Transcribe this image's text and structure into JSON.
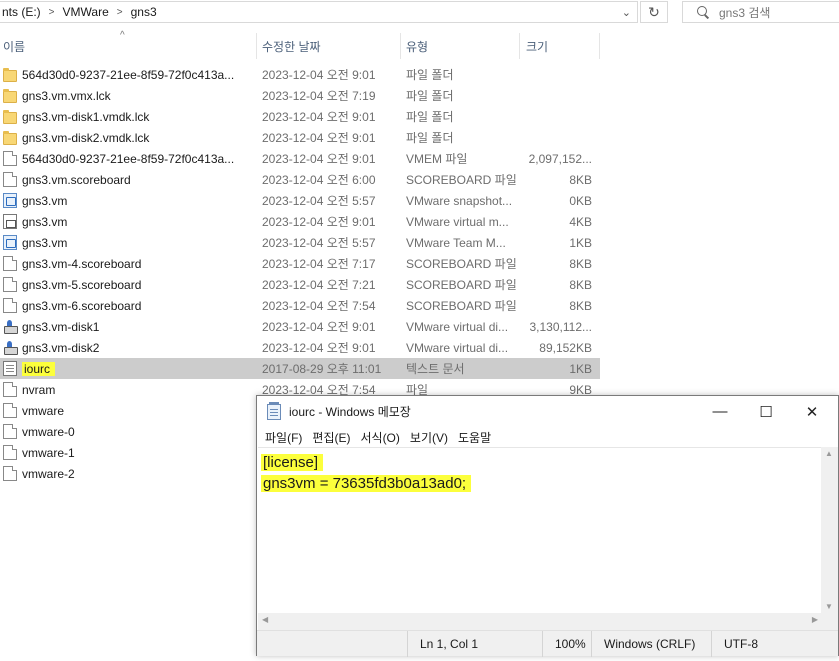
{
  "address": {
    "crumbs": [
      "nts (E:)",
      "VMWare",
      "gns3"
    ],
    "separator": ">",
    "dropdown_icon": "chevron-down-icon",
    "refresh_icon": "refresh-icon"
  },
  "search": {
    "placeholder": "gns3 검색"
  },
  "columns": {
    "name": "이름",
    "date": "수정한 날짜",
    "type": "유형",
    "size": "크기"
  },
  "files": [
    {
      "name": "564d30d0-9237-21ee-8f59-72f0c413a...",
      "date": "2023-12-04 오전 9:01",
      "type": "파일 폴더",
      "size": "",
      "icon": "folder"
    },
    {
      "name": "gns3.vm.vmx.lck",
      "date": "2023-12-04 오전 7:19",
      "type": "파일 폴더",
      "size": "",
      "icon": "folder"
    },
    {
      "name": "gns3.vm-disk1.vmdk.lck",
      "date": "2023-12-04 오전 9:01",
      "type": "파일 폴더",
      "size": "",
      "icon": "folder"
    },
    {
      "name": "gns3.vm-disk2.vmdk.lck",
      "date": "2023-12-04 오전 9:01",
      "type": "파일 폴더",
      "size": "",
      "icon": "folder"
    },
    {
      "name": "564d30d0-9237-21ee-8f59-72f0c413a...",
      "date": "2023-12-04 오전 9:01",
      "type": "VMEM 파일",
      "size": "2,097,152...",
      "icon": "doc"
    },
    {
      "name": "gns3.vm.scoreboard",
      "date": "2023-12-04 오전 6:00",
      "type": "SCOREBOARD 파일",
      "size": "8KB",
      "icon": "doc"
    },
    {
      "name": "gns3.vm",
      "date": "2023-12-04 오전 5:57",
      "type": "VMware snapshot...",
      "size": "0KB",
      "icon": "vmsnap"
    },
    {
      "name": "gns3.vm",
      "date": "2023-12-04 오전 9:01",
      "type": "VMware virtual m...",
      "size": "4KB",
      "icon": "vmx"
    },
    {
      "name": "gns3.vm",
      "date": "2023-12-04 오전 5:57",
      "type": "VMware Team M...",
      "size": "1KB",
      "icon": "vmsnap"
    },
    {
      "name": "gns3.vm-4.scoreboard",
      "date": "2023-12-04 오전 7:17",
      "type": "SCOREBOARD 파일",
      "size": "8KB",
      "icon": "doc"
    },
    {
      "name": "gns3.vm-5.scoreboard",
      "date": "2023-12-04 오전 7:21",
      "type": "SCOREBOARD 파일",
      "size": "8KB",
      "icon": "doc"
    },
    {
      "name": "gns3.vm-6.scoreboard",
      "date": "2023-12-04 오전 7:54",
      "type": "SCOREBOARD 파일",
      "size": "8KB",
      "icon": "doc"
    },
    {
      "name": "gns3.vm-disk1",
      "date": "2023-12-04 오전 9:01",
      "type": "VMware virtual di...",
      "size": "3,130,112...",
      "icon": "disk"
    },
    {
      "name": "gns3.vm-disk2",
      "date": "2023-12-04 오전 9:01",
      "type": "VMware virtual di...",
      "size": "89,152KB",
      "icon": "disk"
    },
    {
      "name": "iourc",
      "date": "2017-08-29 오후 11:01",
      "type": "텍스트 문서",
      "size": "1KB",
      "icon": "txt",
      "selected": true
    },
    {
      "name": "nvram",
      "date": "2023-12-04 오전 7:54",
      "type": "파일",
      "size": "9KB",
      "icon": "doc"
    },
    {
      "name": "vmware",
      "date": "",
      "type": "",
      "size": "",
      "icon": "doc"
    },
    {
      "name": "vmware-0",
      "date": "",
      "type": "",
      "size": "",
      "icon": "doc"
    },
    {
      "name": "vmware-1",
      "date": "",
      "type": "",
      "size": "",
      "icon": "doc"
    },
    {
      "name": "vmware-2",
      "date": "",
      "type": "",
      "size": "",
      "icon": "doc"
    }
  ],
  "notepad": {
    "title": "iourc - Windows 메모장",
    "controls": {
      "minimize": "—",
      "maximize": "☐",
      "close": "✕"
    },
    "menu": [
      "파일(F)",
      "편집(E)",
      "서식(O)",
      "보기(V)",
      "도움말"
    ],
    "lines": [
      "[license]",
      "gns3vm = 73635fd3b0a13ad0;"
    ],
    "status": {
      "position": "Ln 1, Col 1",
      "zoom": "100%",
      "line_ending": "Windows (CRLF)",
      "encoding": "UTF-8"
    }
  },
  "colors": {
    "highlight": "#fcff3c",
    "selected_row": "#cccccc",
    "header_text": "#4c607a"
  }
}
